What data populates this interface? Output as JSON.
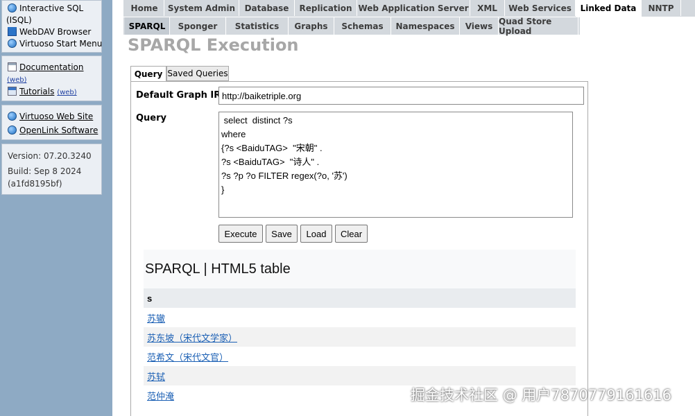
{
  "sidebar": {
    "panel1": [
      {
        "label": "Interactive SQL",
        "icon": "globe-icon"
      },
      {
        "label": "(ISQL)"
      },
      {
        "label": "WebDAV Browser",
        "icon": "folder-icon"
      },
      {
        "label": "Virtuoso Start Menu",
        "icon": "globe-icon"
      }
    ],
    "documentation": {
      "label": "Documentation",
      "web": "(web)"
    },
    "tutorials": {
      "label": "Tutorials",
      "web": "(web)"
    },
    "virtuoso_site": "Virtuoso Web Site",
    "openlink": "OpenLink Software",
    "version": "Version: 07.20.3240",
    "build": "Build: Sep 8 2024",
    "build_id": "(a1fd8195bf)"
  },
  "tabs_top": [
    "Home",
    "System Admin",
    "Database",
    "Replication",
    "Web Application Server",
    "XML",
    "Web Services",
    "Linked Data",
    "NNTP"
  ],
  "tabs_top_active": "Linked Data",
  "tabs_sub": [
    "SPARQL",
    "Sponger",
    "Statistics",
    "Graphs",
    "Schemas",
    "Namespaces",
    "Views",
    "Quad Store Upload"
  ],
  "tabs_sub_active": "SPARQL",
  "page_title": "SPARQL Execution",
  "subtabs": {
    "query": "Query",
    "saved": "Saved Queries"
  },
  "form": {
    "iri_label": "Default Graph IRI",
    "iri_value": "http://baiketriple.org",
    "query_label": "Query",
    "query_value": " select  distinct ?s\nwhere\n{?s <BaiduTAG>  \"宋朝\" .\n?s <BaiduTAG>  \"诗人\" .\n?s ?p ?o FILTER regex(?o, '苏')\n}"
  },
  "buttons": {
    "execute": "Execute",
    "save": "Save",
    "load": "Load",
    "clear": "Clear"
  },
  "results": {
    "title": "SPARQL | HTML5 table",
    "header": "s",
    "rows": [
      "苏辙",
      "苏东坡（宋代文学家）",
      "范希文（宋代文官）",
      "苏轼",
      "范仲淹"
    ]
  },
  "watermark": "掘金技术社区 @ 用户7870779161616"
}
